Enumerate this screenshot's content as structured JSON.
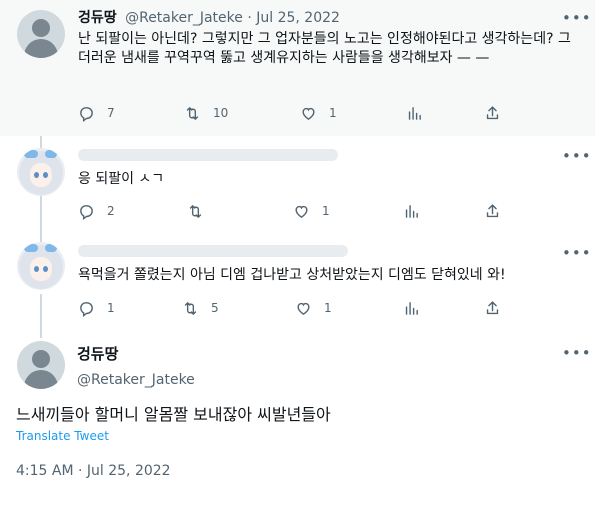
{
  "tweets": [
    {
      "name": "겅듀땅",
      "handle": "@Retaker_Jateke",
      "separator": "·",
      "date": "Jul 25, 2022",
      "text": "난 되팔이는 아닌데? 그렇지만 그 업자분들의 노고는 인정해야된다고 생각하는데? 그 더러운 냄새를 꾸역꾸역 뚫고 생계유지하는 사람들을 생각해보자 — —",
      "replies": "7",
      "retweets": "10",
      "likes": "1",
      "views": ""
    },
    {
      "name": "",
      "handle": "",
      "text": "응 되팔이 ㅅㄱ",
      "replies": "2",
      "retweets": "",
      "likes": "1",
      "views": ""
    },
    {
      "name": "",
      "handle": "",
      "text": "욕먹을거 쫄렸는지 아님 디엠 겁나받고 상처받았는지 디엠도 닫혀있네 와!",
      "replies": "1",
      "retweets": "5",
      "likes": "1",
      "views": ""
    }
  ],
  "main_tweet": {
    "name": "겅듀땅",
    "handle": "@Retaker_Jateke",
    "text": "느새끼들아 할머니 알몸짤 보내잖아 씨발년들아",
    "translate_label": "Translate Tweet",
    "timestamp": "4:15 AM · Jul 25, 2022"
  },
  "icons": {
    "more": "more-horizontal-icon",
    "reply": "reply-icon",
    "retweet": "retweet-icon",
    "like": "heart-icon",
    "views": "analytics-icon",
    "share": "share-icon"
  },
  "colors": {
    "link": "#1d9bf0",
    "secondary_text": "#536471",
    "primary_text": "#0f1419",
    "highlight_bg": "#f7f9f9",
    "thread_line": "#cfd9de"
  }
}
